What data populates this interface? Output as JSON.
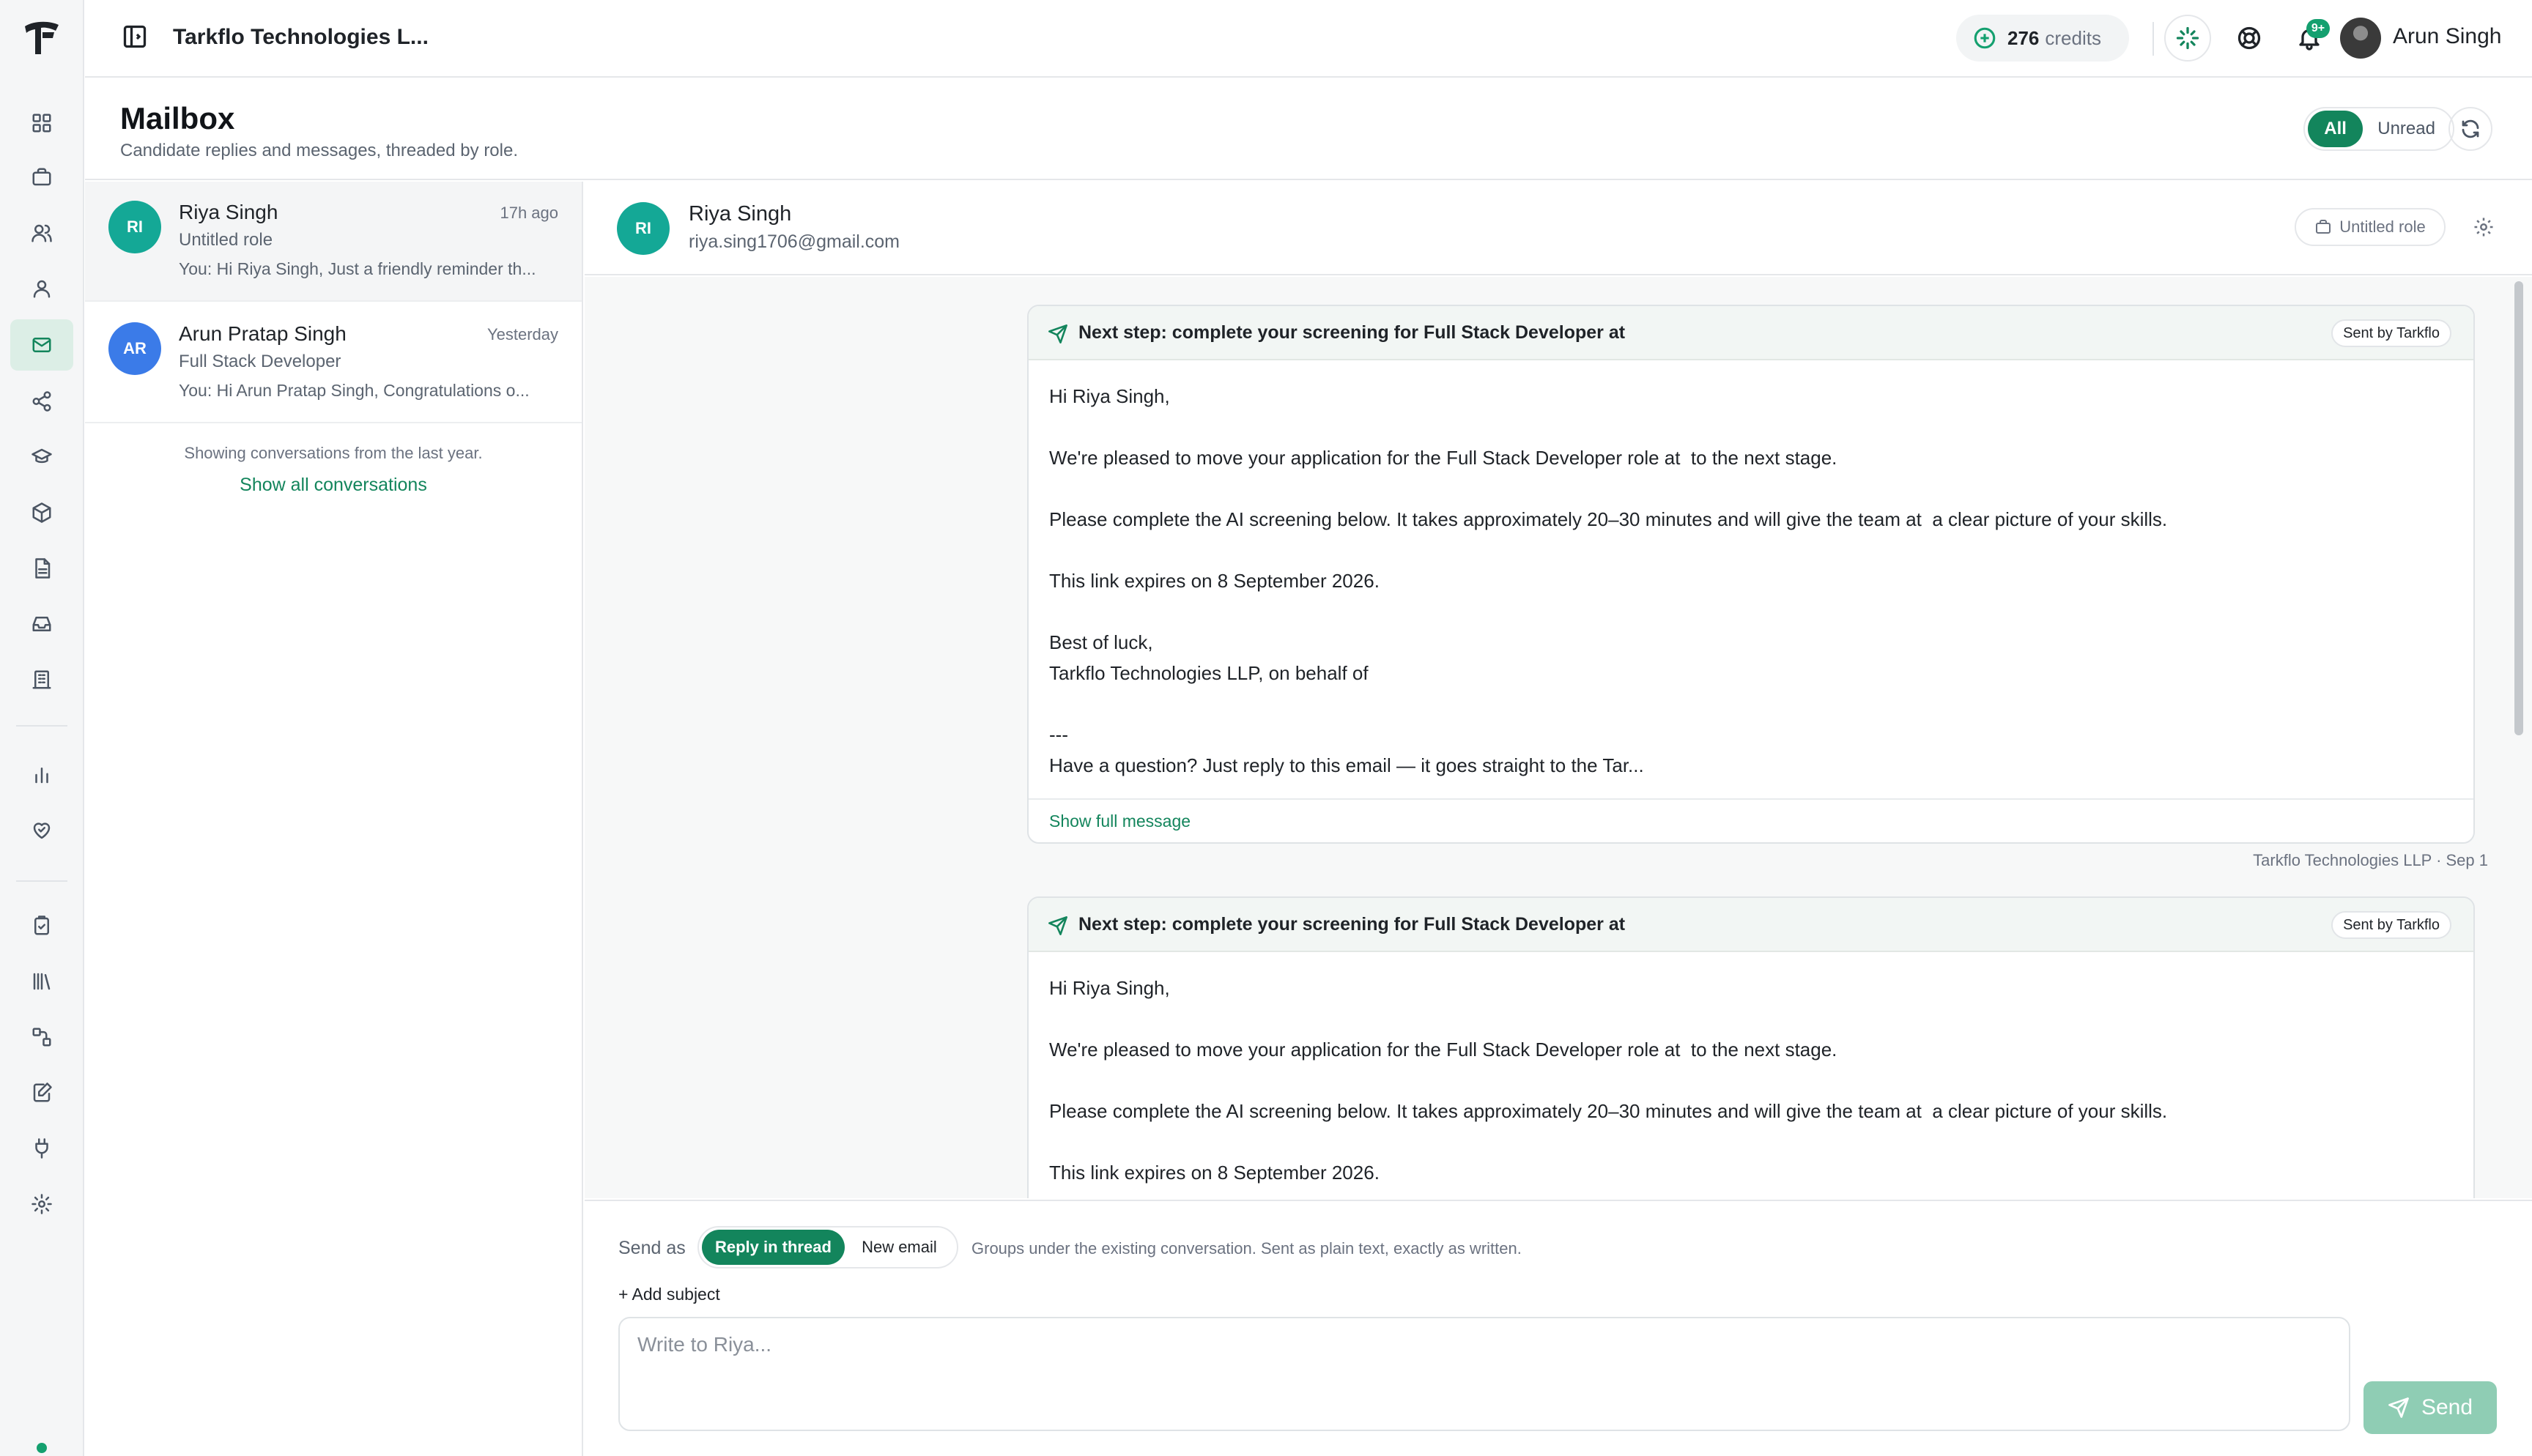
{
  "topbar": {
    "org_name": "Tarkflo Technologies L...",
    "credits_value": "276",
    "credits_label": "credits",
    "notifications_badge": "9+",
    "user_name": "Arun Singh"
  },
  "rail": {
    "items": [
      "dashboard-icon",
      "briefcase-icon",
      "users-icon",
      "candidates-icon",
      "mail-icon",
      "share-icon",
      "graduation-cap-icon",
      "package-icon",
      "document-icon",
      "inbox-icon",
      "building-icon",
      "bar-chart-icon",
      "heart-handshake-icon",
      "clipboard-check-icon",
      "library-icon",
      "workflow-icon",
      "edit-note-icon",
      "plug-icon",
      "gear-icon"
    ],
    "active": "mail-icon"
  },
  "page": {
    "title": "Mailbox",
    "subtitle": "Candidate replies and messages, threaded by role.",
    "filter_all": "All",
    "filter_unread": "Unread"
  },
  "conversations": [
    {
      "initials": "RI",
      "name": "Riya Singh",
      "time": "17h ago",
      "role": "Untitled role",
      "preview": "You: Hi Riya Singh, Just a friendly reminder th...",
      "avatar_color": "#14a896"
    },
    {
      "initials": "AR",
      "name": "Arun Pratap Singh",
      "time": "Yesterday",
      "role": "Full Stack Developer",
      "preview": "You: Hi Arun Pratap Singh, Congratulations o...",
      "avatar_color": "#3b7be8"
    }
  ],
  "list_footer": {
    "note": "Showing conversations from the last year.",
    "link": "Show all conversations"
  },
  "thread": {
    "initials": "RI",
    "name": "Riya Singh",
    "email": "riya.sing1706@gmail.com",
    "role_pill": "Untitled role",
    "messages": [
      {
        "subject": "Next step: complete your screening for Full Stack Developer at",
        "sent_by": "Sent by Tarkflo",
        "lines": [
          "Hi Riya Singh,",
          "",
          "We're pleased to move your application for the Full Stack Developer role at  to the next stage.",
          "",
          "Please complete the AI screening below. It takes approximately 20–30 minutes and will give the team at  a clear picture of your skills.",
          "",
          "This link expires on 8 September 2026.",
          "",
          "Best of luck,",
          "Tarkflo Technologies LLP, on behalf of",
          "",
          "---",
          "Have a question? Just reply to this email — it goes straight to the Tar..."
        ],
        "show_full": "Show full message",
        "meta": "Tarkflo Technologies LLP · Sep 1"
      },
      {
        "subject": "Next step: complete your screening for Full Stack Developer at",
        "sent_by": "Sent by Tarkflo",
        "lines": [
          "Hi Riya Singh,",
          "",
          "We're pleased to move your application for the Full Stack Developer role at  to the next stage.",
          "",
          "Please complete the AI screening below. It takes approximately 20–30 minutes and will give the team at  a clear picture of your skills.",
          "",
          "This link expires on 8 September 2026."
        ]
      }
    ]
  },
  "composer": {
    "send_as_label": "Send as",
    "reply_in_thread": "Reply in thread",
    "new_email": "New email",
    "hint": "Groups under the existing conversation. Sent as plain text, exactly as written.",
    "add_subject": "+ Add subject",
    "placeholder": "Write to Riya...",
    "send_label": "Send"
  }
}
